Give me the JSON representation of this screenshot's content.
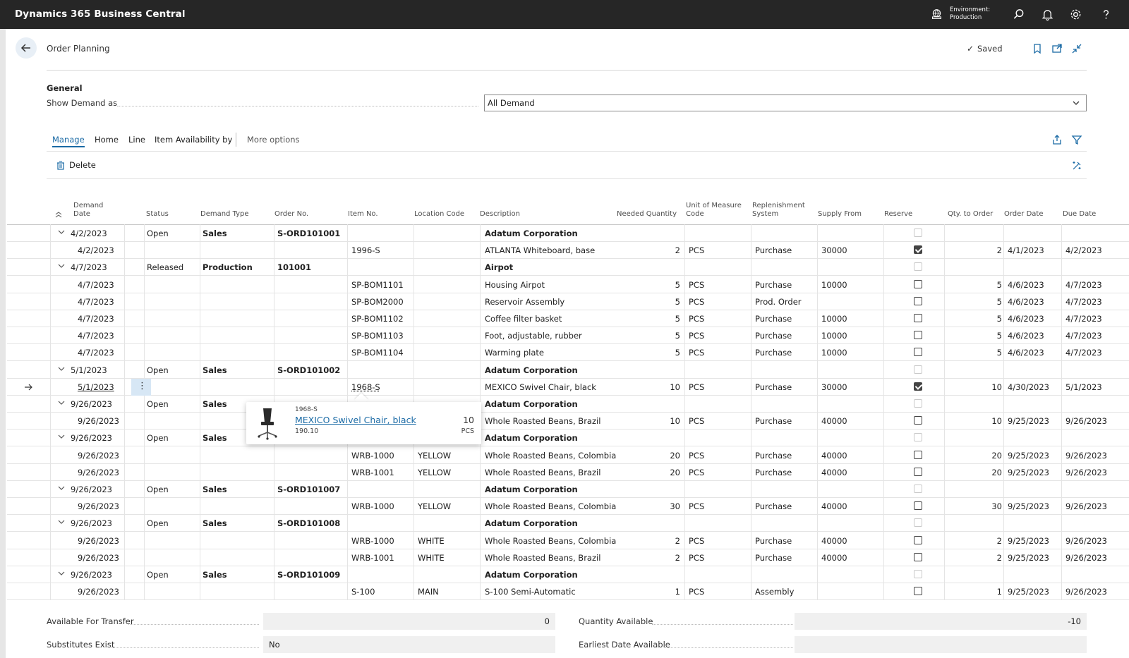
{
  "app": {
    "title": "Dynamics 365 Business Central",
    "environment_label": "Environment:",
    "environment_value": "Production"
  },
  "header": {
    "title": "Order Planning",
    "saved": "Saved"
  },
  "general": {
    "heading": "General",
    "show_demand_label": "Show Demand as",
    "show_demand_value": "All Demand"
  },
  "actions": {
    "manage": "Manage",
    "home": "Home",
    "line": "Line",
    "item_availability": "Item Availability by",
    "more": "More options",
    "delete": "Delete"
  },
  "columns": {
    "demand_date_1": "Demand",
    "demand_date_2": "Date",
    "status": "Status",
    "demand_type": "Demand Type",
    "order_no": "Order No.",
    "item_no": "Item No.",
    "location_code": "Location Code",
    "description": "Description",
    "needed_qty": "Needed Quantity",
    "uom_1": "Unit of Measure",
    "uom_2": "Code",
    "repl_1": "Replenishment",
    "repl_2": "System",
    "supply_from": "Supply From",
    "reserve": "Reserve",
    "qty_to_order": "Qty. to Order",
    "order_date": "Order Date",
    "due_date": "Due Date"
  },
  "rows": [
    {
      "g": true,
      "date": "4/2/2023",
      "status": "Open",
      "type": "Sales",
      "order": "S-ORD101001",
      "desc": "Adatum Corporation"
    },
    {
      "date": "4/2/2023",
      "item": "1996-S",
      "desc": "ATLANTA Whiteboard, base",
      "qty": "2",
      "uom": "PCS",
      "repl": "Purchase",
      "supply": "30000",
      "reserve": true,
      "qto": "2",
      "od": "4/1/2023",
      "dd": "4/2/2023"
    },
    {
      "g": true,
      "date": "4/7/2023",
      "status": "Released",
      "type": "Production",
      "order": "101001",
      "desc": "Airpot"
    },
    {
      "date": "4/7/2023",
      "item": "SP-BOM1101",
      "desc": "Housing Airpot",
      "qty": "5",
      "uom": "PCS",
      "repl": "Purchase",
      "supply": "10000",
      "qto": "5",
      "od": "4/6/2023",
      "dd": "4/7/2023"
    },
    {
      "date": "4/7/2023",
      "item": "SP-BOM2000",
      "desc": "Reservoir Assembly",
      "qty": "5",
      "uom": "PCS",
      "repl": "Prod. Order",
      "supply": "",
      "qto": "5",
      "od": "4/6/2023",
      "dd": "4/7/2023"
    },
    {
      "date": "4/7/2023",
      "item": "SP-BOM1102",
      "desc": "Coffee filter basket",
      "qty": "5",
      "uom": "PCS",
      "repl": "Purchase",
      "supply": "10000",
      "qto": "5",
      "od": "4/6/2023",
      "dd": "4/7/2023"
    },
    {
      "date": "4/7/2023",
      "item": "SP-BOM1103",
      "desc": "Foot, adjustable, rubber",
      "qty": "5",
      "uom": "PCS",
      "repl": "Purchase",
      "supply": "10000",
      "qto": "5",
      "od": "4/6/2023",
      "dd": "4/7/2023"
    },
    {
      "date": "4/7/2023",
      "item": "SP-BOM1104",
      "desc": "Warming plate",
      "qty": "5",
      "uom": "PCS",
      "repl": "Purchase",
      "supply": "10000",
      "qto": "5",
      "od": "4/6/2023",
      "dd": "4/7/2023"
    },
    {
      "g": true,
      "date": "5/1/2023",
      "status": "Open",
      "type": "Sales",
      "order": "S-ORD101002",
      "desc": "Adatum Corporation"
    },
    {
      "sel": true,
      "date": "5/1/2023",
      "item": "1968-S",
      "desc": "MEXICO Swivel Chair, black",
      "qty": "10",
      "uom": "PCS",
      "repl": "Purchase",
      "supply": "30000",
      "reserve": true,
      "qto": "10",
      "od": "4/30/2023",
      "dd": "5/1/2023"
    },
    {
      "g": true,
      "date": "9/26/2023",
      "status": "Open",
      "type": "Sales",
      "order": "",
      "desc": "Adatum Corporation"
    },
    {
      "date": "9/26/2023",
      "item": "",
      "desc": "Whole Roasted Beans, Brazil",
      "qty": "10",
      "uom": "PCS",
      "repl": "Purchase",
      "supply": "40000",
      "qto": "10",
      "od": "9/25/2023",
      "dd": "9/26/2023"
    },
    {
      "g": true,
      "date": "9/26/2023",
      "status": "Open",
      "type": "Sales",
      "order": "",
      "desc": "Adatum Corporation"
    },
    {
      "date": "9/26/2023",
      "item": "WRB-1000",
      "loc": "YELLOW",
      "desc": "Whole Roasted Beans, Colombia",
      "qty": "20",
      "uom": "PCS",
      "repl": "Purchase",
      "supply": "40000",
      "qto": "20",
      "od": "9/25/2023",
      "dd": "9/26/2023"
    },
    {
      "date": "9/26/2023",
      "item": "WRB-1001",
      "loc": "YELLOW",
      "desc": "Whole Roasted Beans, Brazil",
      "qty": "20",
      "uom": "PCS",
      "repl": "Purchase",
      "supply": "40000",
      "qto": "20",
      "od": "9/25/2023",
      "dd": "9/26/2023"
    },
    {
      "g": true,
      "date": "9/26/2023",
      "status": "Open",
      "type": "Sales",
      "order": "S-ORD101007",
      "desc": "Adatum Corporation"
    },
    {
      "date": "9/26/2023",
      "item": "WRB-1000",
      "loc": "YELLOW",
      "desc": "Whole Roasted Beans, Colombia",
      "qty": "30",
      "uom": "PCS",
      "repl": "Purchase",
      "supply": "40000",
      "qto": "30",
      "od": "9/25/2023",
      "dd": "9/26/2023"
    },
    {
      "g": true,
      "date": "9/26/2023",
      "status": "Open",
      "type": "Sales",
      "order": "S-ORD101008",
      "desc": "Adatum Corporation"
    },
    {
      "date": "9/26/2023",
      "item": "WRB-1000",
      "loc": "WHITE",
      "desc": "Whole Roasted Beans, Colombia",
      "qty": "2",
      "uom": "PCS",
      "repl": "Purchase",
      "supply": "40000",
      "qto": "2",
      "od": "9/25/2023",
      "dd": "9/26/2023"
    },
    {
      "date": "9/26/2023",
      "item": "WRB-1001",
      "loc": "WHITE",
      "desc": "Whole Roasted Beans, Brazil",
      "qty": "2",
      "uom": "PCS",
      "repl": "Purchase",
      "supply": "40000",
      "qto": "2",
      "od": "9/25/2023",
      "dd": "9/26/2023"
    },
    {
      "g": true,
      "date": "9/26/2023",
      "status": "Open",
      "type": "Sales",
      "order": "S-ORD101009",
      "desc": "Adatum Corporation"
    },
    {
      "date": "9/26/2023",
      "item": "S-100",
      "loc": "MAIN",
      "desc": "S-100 Semi-Automatic",
      "qty": "1",
      "uom": "PCS",
      "repl": "Assembly",
      "supply": "",
      "qto": "1",
      "od": "9/25/2023",
      "dd": "9/26/2023"
    }
  ],
  "popup": {
    "item_no": "1968-S",
    "name": "MEXICO Swivel Chair, black",
    "price": "190.10",
    "qty": "10",
    "uom": "PCS"
  },
  "footer": {
    "available_transfer_label": "Available For Transfer",
    "available_transfer_value": "0",
    "substitutes_label": "Substitutes Exist",
    "substitutes_value": "No",
    "qty_available_label": "Quantity Available",
    "qty_available_value": "-10",
    "earliest_date_label": "Earliest Date Available",
    "earliest_date_value": ""
  },
  "colors": {
    "topbar": "#262626",
    "accent": "#1a6aa5",
    "selection": "#d7e7f5"
  }
}
